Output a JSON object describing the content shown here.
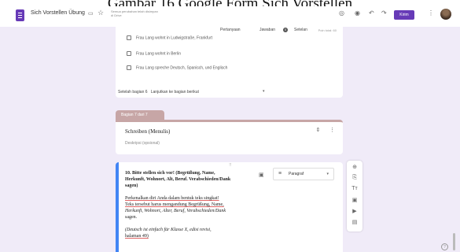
{
  "caption": "Gambar 16 Google Form Sich Vorstellen",
  "topbar": {
    "title": "Sich Vorstellen Übung",
    "drive_note": "Semua perubahan telah disimpan di Drive",
    "send_label": "Kirim"
  },
  "tabs": {
    "questions": "Pertanyaan",
    "responses": "Jawaban",
    "responses_count": "0",
    "settings": "Setelan",
    "points": "Poin total: 60"
  },
  "options": [
    "Frau Lang wohnt in Ludwigstraße, Frankfurt",
    "Frau Lang wohnt in Berlin",
    "Frau Lang spreche Deutsch, Spanisch, und Englisch"
  ],
  "after_section": {
    "label": "Setelah bagian 6",
    "value": "Lanjutkan ke bagian berikut"
  },
  "section": {
    "tab_label": "Bagian 7 dari 7",
    "title": "Schreiben (Menulis)",
    "description": "Deskripsi (opsional)"
  },
  "question": {
    "title_lines": [
      "10. Bitte stellen sich vor! (Begrüßung, Name,",
      "Herkunft, Wohnort, Alt, Beruf. Verabschieden/Dank",
      "sagen)"
    ],
    "body_lines": [
      "Perkenalkan diri Anda dalam bentuk teks singkat!",
      "Teks tersebut harus mengandung Begrüßung, Name,",
      "Herkunft, Wohnort, Alter, Beruf, Verabschieden/Dank",
      "sagen."
    ],
    "note_lines": [
      "(Deutsch ist einfach für Klasse X, edisi revisi,",
      "halaman 49)"
    ],
    "type_label": "Paragraf"
  },
  "icons": {
    "folder": "folder-icon",
    "star": "star-icon",
    "palette": "palette-icon",
    "preview": "eye-icon",
    "undo": "undo-icon",
    "redo": "redo-icon",
    "more": "more-vert-icon",
    "image": "image-icon",
    "add_question": "add-circle-icon",
    "import": "import-icon",
    "title": "title-icon",
    "add_image": "image-icon",
    "add_video": "video-icon",
    "add_section": "section-icon",
    "help": "help-icon"
  },
  "colors": {
    "accent": "#673ab7",
    "background": "#f0ebf8",
    "section": "#c7a6a6",
    "focus": "#4285f4"
  }
}
